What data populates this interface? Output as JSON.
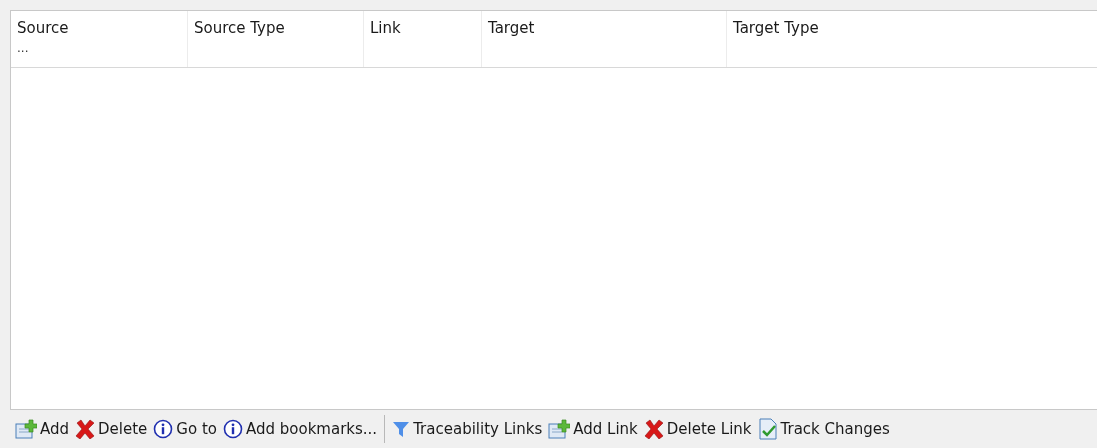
{
  "table": {
    "columns": [
      {
        "label": "Source",
        "note": "..."
      },
      {
        "label": "Source Type"
      },
      {
        "label": "Link"
      },
      {
        "label": "Target"
      },
      {
        "label": "Target Type"
      }
    ]
  },
  "toolbar": {
    "groups": [
      [
        {
          "kind": "add",
          "label": "Add"
        },
        {
          "kind": "delete",
          "label": "Delete"
        },
        {
          "kind": "info",
          "label": "Go to"
        },
        {
          "kind": "info",
          "label": "Add bookmarks..."
        }
      ],
      [
        {
          "kind": "filter",
          "label": "Traceability Links"
        },
        {
          "kind": "add",
          "label": "Add Link"
        },
        {
          "kind": "delete",
          "label": "Delete Link"
        },
        {
          "kind": "track",
          "label": "Track Changes"
        }
      ]
    ]
  }
}
